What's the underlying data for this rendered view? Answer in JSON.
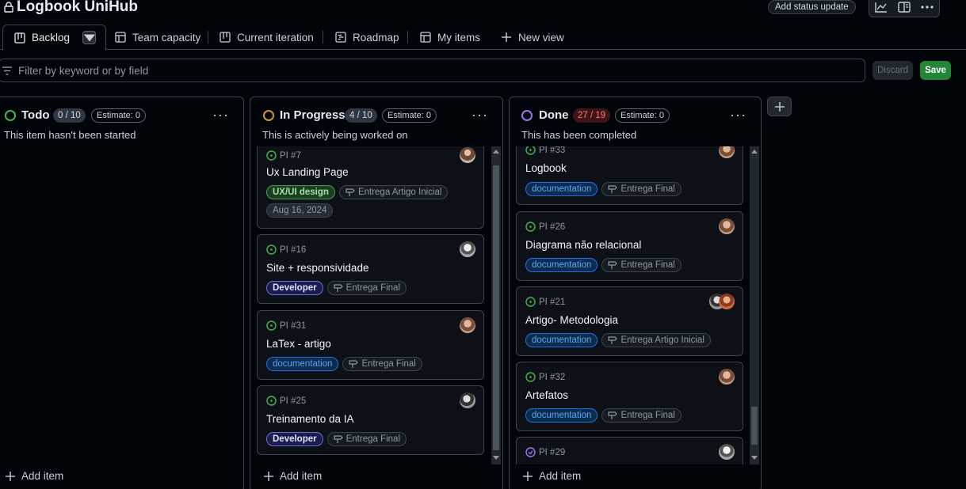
{
  "header": {
    "title": "Logbook UniHub",
    "status_update": "Add status update"
  },
  "tabs": [
    {
      "label": "Backlog"
    },
    {
      "label": "Team capacity"
    },
    {
      "label": "Current iteration"
    },
    {
      "label": "Roadmap"
    },
    {
      "label": "My items"
    },
    {
      "label": "New view"
    }
  ],
  "filter": {
    "placeholder": "Filter by keyword or by field",
    "discard": "Discard",
    "save": "Save"
  },
  "colors": {
    "todo": "#3fb950",
    "in_progress": "#d29922",
    "done": "#a371f7",
    "open_issue": "#3fb950",
    "closed_issue": "#a371f7"
  },
  "columns": {
    "todo": {
      "name": "Todo",
      "count": "0 / 10",
      "estimate": "Estimate: 0",
      "description": "This item hasn't been started",
      "add_item": "Add item"
    },
    "in_progress": {
      "name": "In Progress",
      "count": "4 / 10",
      "estimate": "Estimate: 0",
      "description": "This is actively being worked on",
      "add_item": "Add item",
      "cards": [
        {
          "id": "PI #7",
          "title": "Ux Landing Page",
          "labels": [
            "UX/UI design",
            "Entrega Artigo Inicial",
            "Aug 16, 2024"
          ]
        },
        {
          "id": "PI #16",
          "title": "Site + responsividade",
          "labels": [
            "Developer",
            "Entrega Final"
          ]
        },
        {
          "id": "PI #31",
          "title": "LaTex - artigo",
          "labels": [
            "documentation",
            "Entrega Final"
          ]
        },
        {
          "id": "PI #25",
          "title": "Treinamento da IA",
          "labels": [
            "Developer",
            "Entrega Final"
          ]
        }
      ]
    },
    "done": {
      "name": "Done",
      "count": "27 / 19",
      "estimate": "Estimate: 0",
      "description": "This has been completed",
      "add_item": "Add item",
      "cards": [
        {
          "id": "PI #33",
          "title": "Logbook",
          "labels": [
            "documentation",
            "Entrega Final"
          ]
        },
        {
          "id": "PI #26",
          "title": "Diagrama não relacional",
          "labels": [
            "documentation",
            "Entrega Final"
          ]
        },
        {
          "id": "PI #21",
          "title": "Artigo- Metodologia",
          "labels": [
            "documentation",
            "Entrega Artigo Inicial"
          ]
        },
        {
          "id": "PI #32",
          "title": "Artefatos",
          "labels": [
            "documentation",
            "Entrega Final"
          ]
        },
        {
          "id": "PI #29",
          "title": "",
          "labels": []
        }
      ]
    }
  }
}
